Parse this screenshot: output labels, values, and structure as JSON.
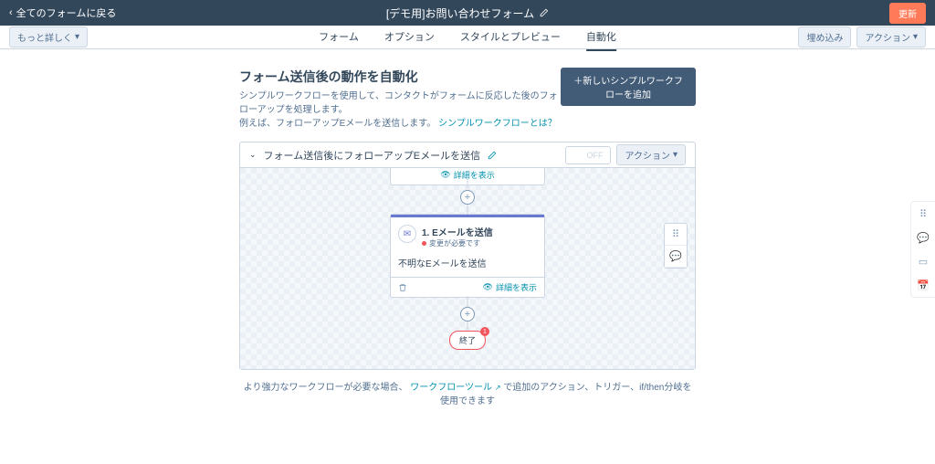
{
  "topbar": {
    "back": "全てのフォームに戻る",
    "title": "[デモ用]お問い合わせフォーム",
    "update": "更新"
  },
  "subbar": {
    "more": "もっと詳しく",
    "embed": "埋め込み",
    "actions": "アクション"
  },
  "tabs": [
    "フォーム",
    "オプション",
    "スタイルとプレビュー",
    "自動化"
  ],
  "activeTab": 3,
  "section": {
    "title": "フォーム送信後の動作を自動化",
    "desc1": "シンプルワークフローを使用して、コンタクトがフォームに反応した後のフォローアップを処理します。",
    "desc2": "例えば、フォローアップEメールを送信します。",
    "link": "シンプルワークフローとは？",
    "addBtn": "＋新しいシンプルワークフローを追加"
  },
  "panel": {
    "title": "フォーム送信後にフォローアップEメールを送信",
    "toggleOff": "OFF",
    "actions": "アクション"
  },
  "workflow": {
    "showDetails": "詳細を表示",
    "step": {
      "num": "1.",
      "title": "Eメールを送信",
      "warn": "変更が必要です",
      "msg": "不明なEメールを送信"
    },
    "end": "終了",
    "endBadge": "1"
  },
  "footer": {
    "pre": "より強力なワークフローが必要な場合、",
    "link": "ワークフローツール",
    "post": " で追加のアクション、トリガー、if/then分岐を使用できます"
  }
}
